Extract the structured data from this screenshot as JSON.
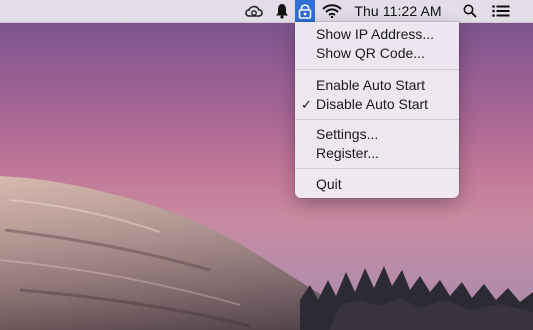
{
  "menubar": {
    "clock": "Thu 11:22 AM",
    "icons": {
      "creative_cloud": "creative-cloud-icon",
      "notification": "bell-icon",
      "app": "lock-icon",
      "wifi": "wifi-icon",
      "spotlight": "search-icon",
      "notification_center": "list-icon"
    },
    "active_color": "#2f6fd6"
  },
  "menu": {
    "items": [
      {
        "label": "Show IP Address...",
        "checked": false
      },
      {
        "label": "Show QR Code...",
        "checked": false
      },
      {
        "label": "Enable Auto Start",
        "checked": false
      },
      {
        "label": "Disable Auto Start",
        "checked": true
      },
      {
        "label": "Settings...",
        "checked": false
      },
      {
        "label": "Register...",
        "checked": false
      },
      {
        "label": "Quit",
        "checked": false
      }
    ],
    "checkmark": "✓"
  }
}
